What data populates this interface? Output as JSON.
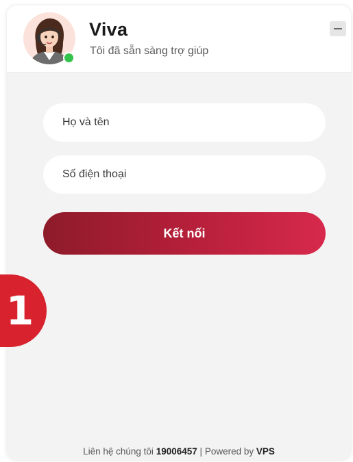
{
  "header": {
    "agent_name": "Viva",
    "agent_status": "Tôi đã sẵn sàng trợ giúp",
    "avatar_icon": "woman-agent-headset-avatar-icon",
    "online_indicator_color": "#33c24a",
    "minimize_icon": "minus-icon"
  },
  "form": {
    "name_placeholder": "Họ và tên",
    "phone_placeholder": "Số điện thoại",
    "connect_label": "Kết nối",
    "connect_gradient": [
      "#8e1b2a",
      "#d7294c"
    ]
  },
  "footer": {
    "contact_label": "Liên hệ chúng tôi",
    "phone": "19006457",
    "separator": "|",
    "powered_label": "Powered by",
    "brand": "VPS"
  },
  "step_badge": {
    "number": "1",
    "color": "#d8232f"
  }
}
